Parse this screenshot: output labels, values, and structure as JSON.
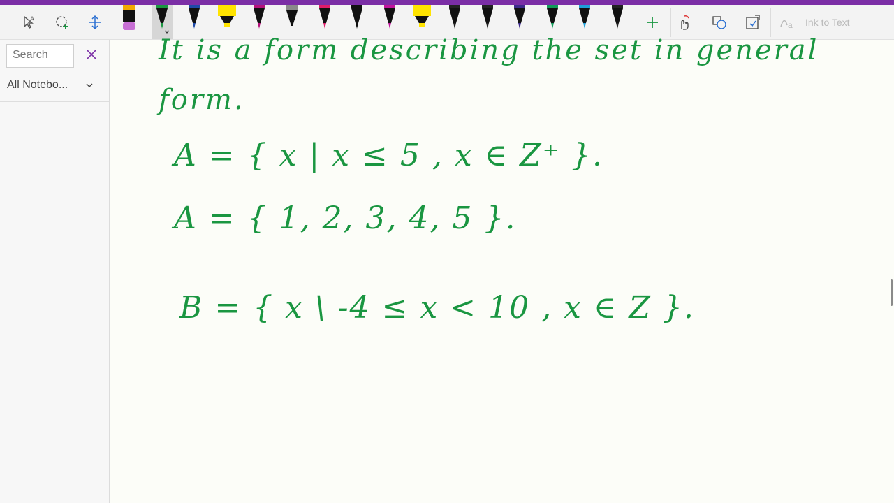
{
  "toolbar": {
    "tools": [
      {
        "name": "lasso-select-icon"
      },
      {
        "name": "add-space-icon"
      },
      {
        "name": "insert-space-icon"
      }
    ],
    "pens": [
      {
        "color": "#f2a900",
        "tip": "#c76fd4",
        "kind": "eraser"
      },
      {
        "color": "#1a9641",
        "tip": "#1a9641",
        "kind": "pen",
        "selected": true
      },
      {
        "color": "#1f4aa8",
        "tip": "#1f4aa8",
        "kind": "pen"
      },
      {
        "color": "#ffe300",
        "tip": "#ffe300",
        "kind": "highlighter"
      },
      {
        "color": "#b5127c",
        "tip": "#b5127c",
        "kind": "pen"
      },
      {
        "color": "#8a8a8a",
        "tip": "#222222",
        "kind": "pencil"
      },
      {
        "color": "#e01c6a",
        "tip": "#e01c6a",
        "kind": "pen"
      },
      {
        "color": "#111111",
        "tip": "#111111",
        "kind": "pen"
      },
      {
        "color": "#c0149c",
        "tip": "#c0149c",
        "kind": "pen"
      },
      {
        "color": "#ffe300",
        "tip": "#ffe300",
        "kind": "highlighter"
      },
      {
        "color": "#222222",
        "tip": "#222222",
        "kind": "pen"
      },
      {
        "color": "#222222",
        "tip": "#222222",
        "kind": "pen"
      },
      {
        "color": "#3d2a8a",
        "tip": "#3d2a8a",
        "kind": "pen"
      },
      {
        "color": "#129a5a",
        "tip": "#129a5a",
        "kind": "pen"
      },
      {
        "color": "#1f9fd8",
        "tip": "#1f9fd8",
        "kind": "pen"
      },
      {
        "color": "#222222",
        "tip": "#222222",
        "kind": "pen"
      }
    ],
    "add_pen_icon": "plus-icon",
    "right_tools": [
      "touch-draw-icon",
      "ink-to-shape-icon",
      "ink-replay-icon"
    ],
    "ink_to_text_label": "Ink to Text"
  },
  "sidebar": {
    "search_placeholder": "Search",
    "scope_label": "All Notebo..."
  },
  "canvas": {
    "handwriting": [
      "It is a form describing the set in general",
      "form.",
      "A = { x | x ≤ 5 ,   x ∈ Z⁺ }.",
      "A = { 1, 2, 3, 4, 5 }.",
      "B = { x \\ -4 ≤ x < 10 ,   x ∈ Z }."
    ]
  },
  "colors": {
    "accent": "#7b2ea6",
    "ink": "#1a9641",
    "toolbar_bg": "#f3f3f3",
    "page_bg": "#fcfdf8"
  }
}
